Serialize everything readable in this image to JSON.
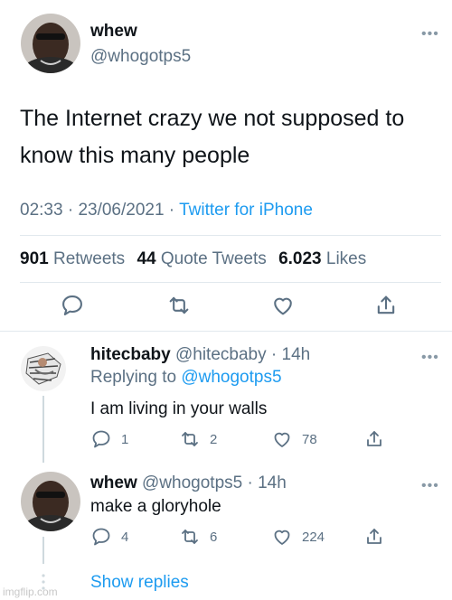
{
  "main_tweet": {
    "author_name": "whew",
    "author_handle": "@whogotps5",
    "text": "The Internet crazy we not supposed to know this many people",
    "time": "02:33",
    "date": "23/06/2021",
    "source": "Twitter for iPhone",
    "stats": {
      "retweets_count": "901",
      "retweets_label": "Retweets",
      "quotes_count": "44",
      "quotes_label": "Quote Tweets",
      "likes_count": "6.023",
      "likes_label": "Likes"
    }
  },
  "replies": [
    {
      "author_name": "hitecbaby",
      "author_handle": "@hitecbaby",
      "age": "14h",
      "replying_prefix": "Replying to",
      "replying_to": "@whogotps5",
      "text": "I am living in your walls",
      "reply_count": "1",
      "retweet_count": "2",
      "like_count": "78"
    },
    {
      "author_name": "whew",
      "author_handle": "@whogotps5",
      "age": "14h",
      "text": "make a gloryhole",
      "reply_count": "4",
      "retweet_count": "6",
      "like_count": "224"
    }
  ],
  "show_replies_label": "Show replies",
  "watermark": "imgflip.com",
  "sep": " · ",
  "colors": {
    "accent": "#1d9bf0",
    "muted": "#5b7083",
    "text": "#0f1419"
  },
  "icons": [
    "reply-icon",
    "retweet-icon",
    "like-icon",
    "share-icon",
    "more-icon"
  ]
}
